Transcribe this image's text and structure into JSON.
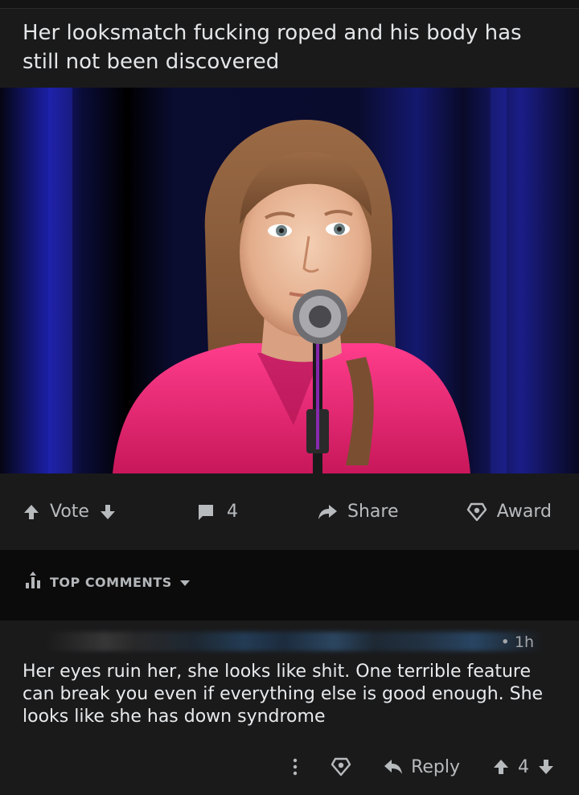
{
  "post": {
    "title": "Her looksmatch fucking roped and his body has still not been discovered"
  },
  "actions": {
    "vote_label": "Vote",
    "comment_count": "4",
    "share_label": "Share",
    "award_label": "Award"
  },
  "comments_header": {
    "sort_label": "TOP COMMENTS"
  },
  "comment": {
    "time": "• 1h",
    "body": "Her eyes ruin her, she looks like shit. One terrible feature can break you even if everything else is good enough. She looks like she has down syndrome",
    "reply_label": "Reply",
    "score": "4"
  },
  "colors": {
    "background": "#1a1a1b",
    "shirt": "#e0236d",
    "curtain": "#1b1fa8"
  }
}
